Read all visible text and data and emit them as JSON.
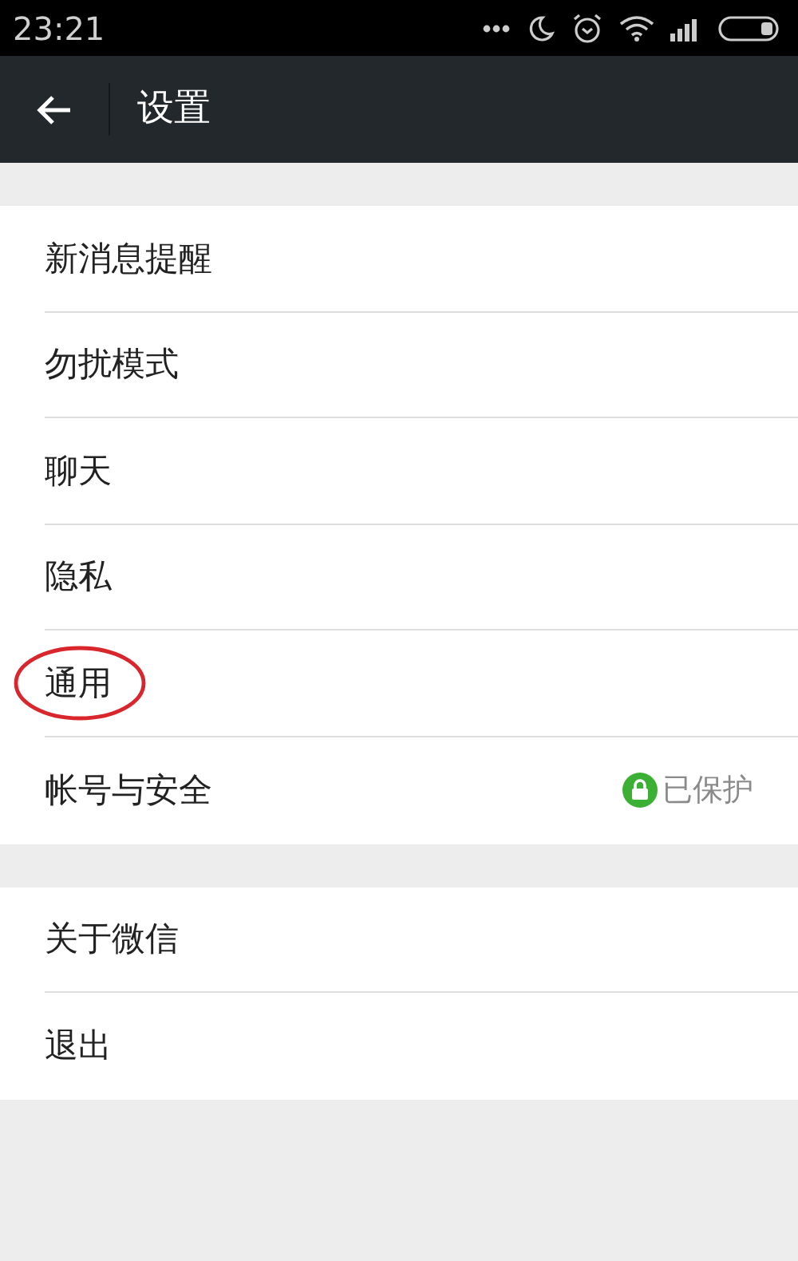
{
  "status_bar": {
    "time": "23:21"
  },
  "header": {
    "title": "设置"
  },
  "groups": [
    {
      "items": [
        {
          "label": "新消息提醒",
          "circled": false
        },
        {
          "label": "勿扰模式",
          "circled": false
        },
        {
          "label": "聊天",
          "circled": false
        },
        {
          "label": "隐私",
          "circled": false
        },
        {
          "label": "通用",
          "circled": true
        },
        {
          "label": "帐号与安全",
          "circled": false,
          "status": "已保护"
        }
      ]
    },
    {
      "items": [
        {
          "label": "关于微信",
          "circled": false
        },
        {
          "label": "退出",
          "circled": false
        }
      ]
    }
  ]
}
